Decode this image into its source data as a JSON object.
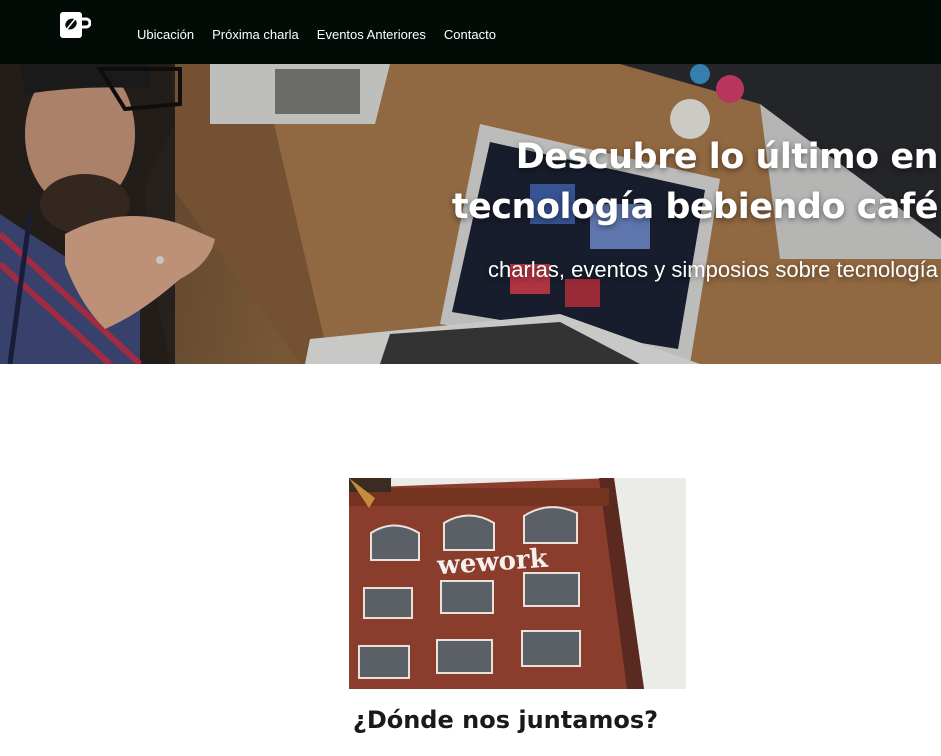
{
  "nav": {
    "logo_icon": "coffee-cup-leaf-icon",
    "items": [
      {
        "label": "Ubicación"
      },
      {
        "label": "Próxima charla"
      },
      {
        "label": "Eventos Anteriores"
      },
      {
        "label": "Contacto"
      }
    ]
  },
  "hero": {
    "title_line1": "Descubre lo último en",
    "title_line2": "tecnología bebiendo café",
    "subtitle": "charlas, eventos y simposios sobre tecnología"
  },
  "location": {
    "sign_text": "wework",
    "heading": "¿Dónde nos juntamos?"
  },
  "colors": {
    "nav_bg": "#020b06",
    "text_light": "#ffffff",
    "heading": "#1a1a1a"
  }
}
